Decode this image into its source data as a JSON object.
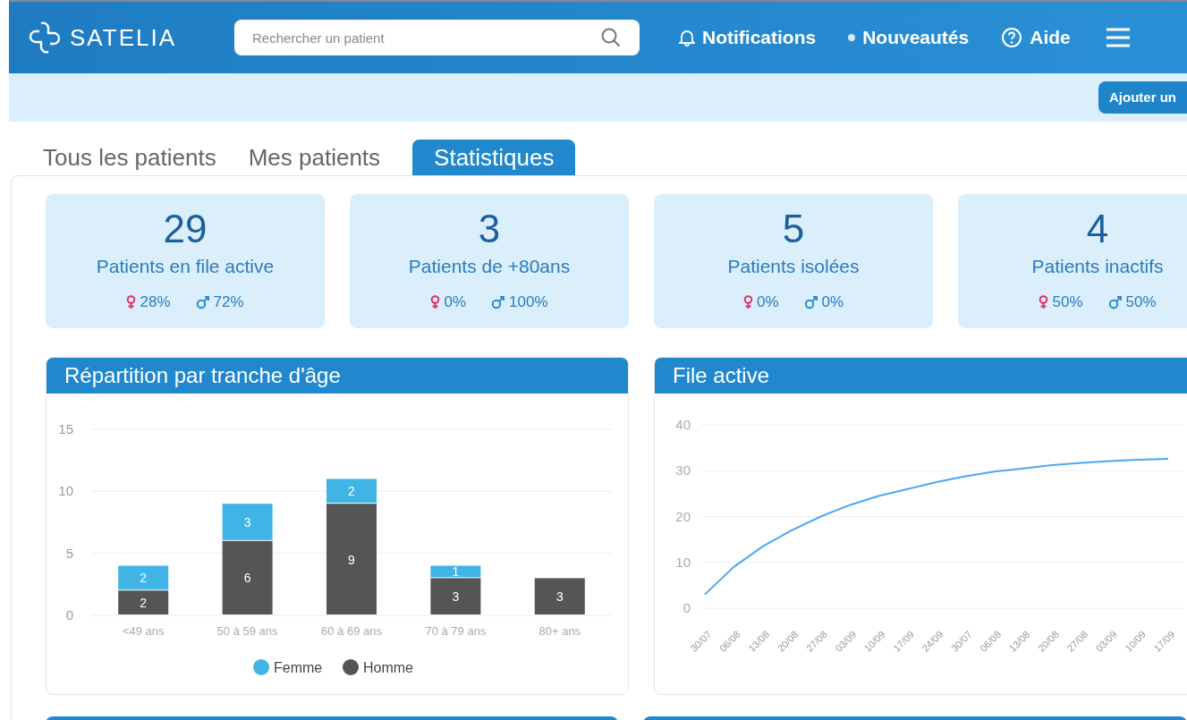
{
  "header": {
    "logo": "SATELIA",
    "search": {
      "placeholder": "Rechercher un patient"
    },
    "nav": [
      {
        "kind": "bell",
        "label": "Notifications"
      },
      {
        "kind": "dot",
        "label": "Nouveautés"
      },
      {
        "kind": "help",
        "label": "Aide"
      }
    ]
  },
  "toolbar": {
    "button": "Ajouter un"
  },
  "tabs": [
    {
      "label": "Tous les patients",
      "selected": false
    },
    {
      "label": "Mes patients",
      "selected": false
    },
    {
      "label": "Statistiques",
      "selected": true
    }
  ],
  "stats": [
    {
      "value": "29",
      "label": "Patients en file active",
      "female": "28%",
      "male": "72%"
    },
    {
      "value": "3",
      "label": "Patients de +80ans",
      "female": "0%",
      "male": "100%"
    },
    {
      "value": "5",
      "label": "Patients isolées",
      "female": "0%",
      "male": "0%"
    },
    {
      "value": "4",
      "label": "Patients inactifs",
      "female": "50%",
      "male": "50%"
    }
  ],
  "age_chart": {
    "title": "Répartition par tranche d'âge",
    "chart_data": {
      "type": "bar",
      "stacked": true,
      "data_labels": true,
      "legend": "bottom",
      "grid": true,
      "categories": [
        "<49 ans",
        "50 à 59 ans",
        "60 à 69 ans",
        "70 à 79 ans",
        "80+ ans"
      ],
      "ylim": [
        0,
        15
      ],
      "yticks": [
        0,
        5,
        10,
        15
      ],
      "series": [
        {
          "name": "Homme",
          "color": "#555555",
          "values": [
            2,
            6,
            9,
            3,
            3
          ]
        },
        {
          "name": "Femme",
          "color": "#3fb4e5",
          "values": [
            2,
            3,
            2,
            1,
            null
          ]
        }
      ]
    }
  },
  "active_chart": {
    "title": "File active",
    "chart_data": {
      "type": "line",
      "x": [
        "30/07",
        "06/08",
        "13/08",
        "20/08",
        "27/08",
        "03/09",
        "10/09",
        "17/09",
        "24/09",
        "30/07",
        "06/08",
        "13/08",
        "20/08",
        "27/08",
        "03/09",
        "10/09",
        "17/09"
      ],
      "ylim": [
        0,
        40
      ],
      "yticks": [
        0,
        10,
        20,
        30,
        40
      ],
      "grid": true,
      "series": [
        {
          "color": "#4aa8f5",
          "values": [
            3,
            9,
            13.5,
            17,
            20,
            22.5,
            24.5,
            26,
            27.5,
            28.8,
            29.8,
            30.5,
            31.2,
            31.7,
            32.1,
            32.4,
            32.6
          ]
        }
      ]
    }
  }
}
